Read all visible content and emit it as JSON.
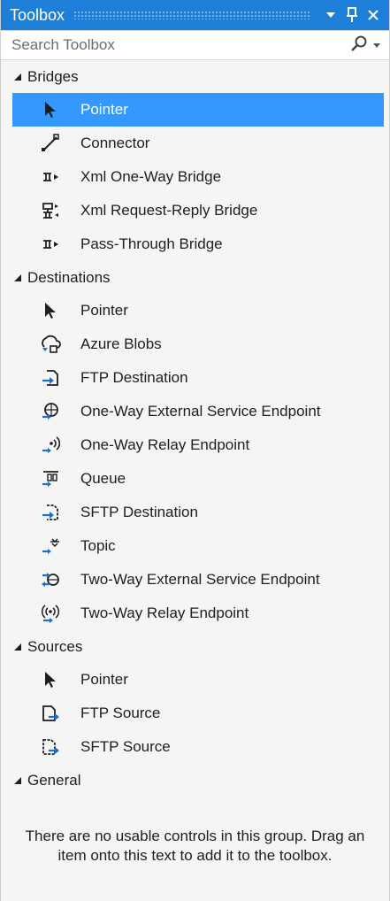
{
  "titlebar": {
    "title": "Toolbox"
  },
  "search": {
    "placeholder": "Search Toolbox"
  },
  "groups": {
    "bridges": {
      "label": "Bridges",
      "items": [
        "Pointer",
        "Connector",
        "Xml One-Way Bridge",
        "Xml Request-Reply Bridge",
        "Pass-Through Bridge"
      ]
    },
    "destinations": {
      "label": "Destinations",
      "items": [
        "Pointer",
        "Azure Blobs",
        "FTP Destination",
        "One-Way External Service Endpoint",
        "One-Way Relay Endpoint",
        "Queue",
        "SFTP Destination",
        "Topic",
        "Two-Way External Service Endpoint",
        "Two-Way Relay Endpoint"
      ]
    },
    "sources": {
      "label": "Sources",
      "items": [
        "Pointer",
        "FTP Source",
        "SFTP Source"
      ]
    },
    "general": {
      "label": "General",
      "empty_message": "There are no usable controls in this group. Drag an item onto this text to add it to the toolbox."
    }
  },
  "selected": {
    "group": "bridges",
    "item": "Pointer"
  },
  "colors": {
    "accent": "#1e7fd8",
    "selection": "#3399ff",
    "icon": "#1e1e1e",
    "icon_blue": "#1c6fc7"
  }
}
